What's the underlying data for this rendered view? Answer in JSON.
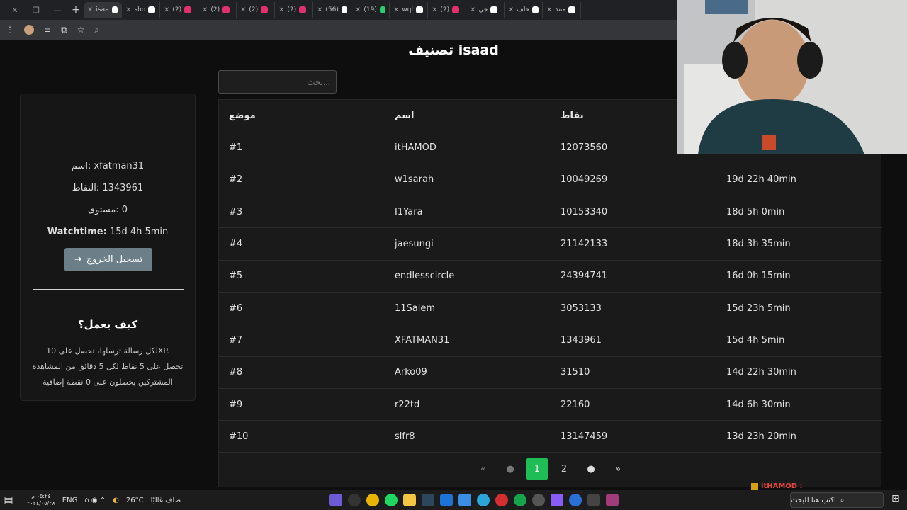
{
  "browser": {
    "tabs": [
      {
        "title": "isaa",
        "color": "#ffffff"
      },
      {
        "title": "sho",
        "color": "#ffffff"
      },
      {
        "title": "(2)",
        "color": "#e1306c"
      },
      {
        "title": "(2)",
        "color": "#e1306c"
      },
      {
        "title": "(2)",
        "color": "#e1306c"
      },
      {
        "title": "(2)",
        "color": "#e1306c"
      },
      {
        "title": "(56)",
        "color": "#ffffff"
      },
      {
        "title": "(19)",
        "color": "#2ecc71"
      },
      {
        "title": "wql",
        "color": "#ffffff"
      },
      {
        "title": "(2)",
        "color": "#e1306c"
      },
      {
        "title": "جي",
        "color": "#ffffff"
      },
      {
        "title": "خلف",
        "color": "#ffffff"
      },
      {
        "title": "منتد",
        "color": "#ffffff"
      }
    ],
    "new_tab": "+",
    "close": "✕"
  },
  "page": {
    "title": "isaad تصنيف",
    "search_placeholder": "...بحث"
  },
  "profile": {
    "name_line": "xfatman31 :اسم",
    "points_line": "1343961 :النقاط",
    "level_line": "0 :مستوى",
    "watchtime_label": "Watchtime:",
    "watchtime_value": "15d 4h 5min",
    "logout_label": "تسجيل الخروج",
    "how_title": "كيف يعمل؟",
    "how_lines": [
      "لكل رسالة ترسلها، تحصل على 10XP.",
      "تحصل على 5 نقاط لكل 5 دقائق من المشاهدة",
      "المشتركين يحصلون على 0 نقطة إضافية"
    ]
  },
  "leaderboard": {
    "headers": [
      "موضع",
      "اسم",
      "نقاط",
      ""
    ],
    "rows": [
      {
        "rank": "#1",
        "name": "itHAMOD",
        "points": "12073560",
        "time": ""
      },
      {
        "rank": "#2",
        "name": "w1sarah",
        "points": "10049269",
        "time": "19d 22h 40min"
      },
      {
        "rank": "#3",
        "name": "I1Yara",
        "points": "10153340",
        "time": "18d 5h 0min"
      },
      {
        "rank": "#4",
        "name": "jaesungi",
        "points": "21142133",
        "time": "18d 3h 35min"
      },
      {
        "rank": "#5",
        "name": "endlesscircle",
        "points": "24394741",
        "time": "16d 0h 15min"
      },
      {
        "rank": "#6",
        "name": "11Salem",
        "points": "3053133",
        "time": "15d 23h 5min"
      },
      {
        "rank": "#7",
        "name": "XFATMAN31",
        "points": "1343961",
        "time": "15d 4h 5min"
      },
      {
        "rank": "#8",
        "name": "Arko09",
        "points": "31510",
        "time": "14d 22h 30min"
      },
      {
        "rank": "#9",
        "name": "r22td",
        "points": "22160",
        "time": "14d 6h 30min"
      },
      {
        "rank": "#10",
        "name": "slfr8",
        "points": "13147459",
        "time": "13d 23h 20min"
      }
    ],
    "pagination": {
      "first": "«",
      "prev": "‹",
      "pages": [
        "1",
        "2"
      ],
      "current": "1",
      "next": "›",
      "last": "»"
    }
  },
  "chat_overlay": {
    "user": "itHAMOD :"
  },
  "taskbar": {
    "lang": "ENG",
    "temperature": "26°C",
    "weather": "صاف غالبًا",
    "search_placeholder": "اكتب هنا للبحث",
    "clock_time": "٠٥:٢٤ م",
    "clock_date": "٢٠٢٤/٠٥/٢٨"
  },
  "colors": {
    "accent": "#1ebd55",
    "logout_button": "#6c7f88"
  }
}
